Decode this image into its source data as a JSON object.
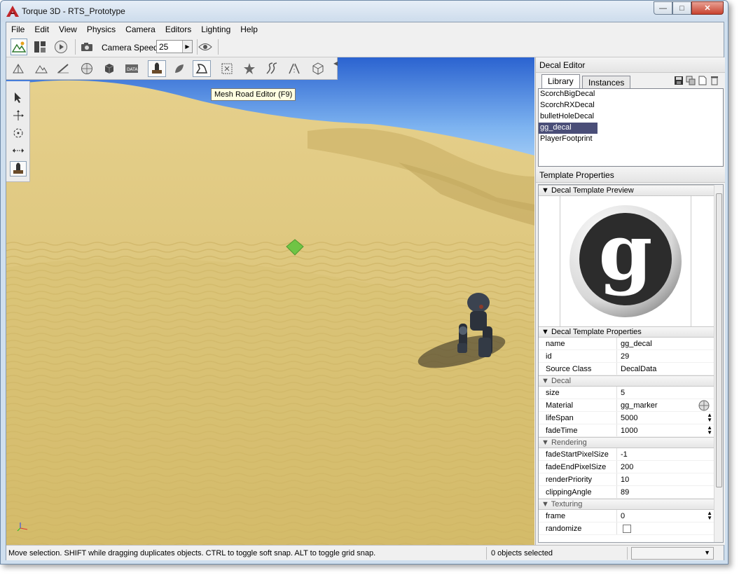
{
  "window": {
    "title": "Torque 3D - RTS_Prototype",
    "minimize": "—",
    "maximize": "□",
    "close": "✕"
  },
  "menu": [
    "File",
    "Edit",
    "View",
    "Physics",
    "Camera",
    "Editors",
    "Lighting",
    "Help"
  ],
  "toolbar": {
    "camera_speed_label": "Camera Speed",
    "camera_speed_value": "25"
  },
  "tooltip": "Mesh Road Editor (F9)",
  "decal_editor": {
    "title": "Decal Editor",
    "tabs": [
      "Library",
      "Instances"
    ],
    "list": [
      "ScorchBigDecal",
      "ScorchRXDecal",
      "bulletHoleDecal",
      "gg_decal",
      "PlayerFootprint"
    ],
    "selected_index": 3
  },
  "template_properties": {
    "title": "Template Properties",
    "preview_section": "Decal Template Preview",
    "props_section": "Decal Template Properties",
    "template_rows": [
      {
        "name": "name",
        "value": "gg_decal"
      },
      {
        "name": "id",
        "value": "29"
      },
      {
        "name": "Source Class",
        "value": "DecalData"
      }
    ],
    "decal_section": "Decal",
    "decal_rows": [
      {
        "name": "size",
        "value": "5"
      },
      {
        "name": "Material",
        "value": "gg_marker"
      },
      {
        "name": "lifeSpan",
        "value": "5000"
      },
      {
        "name": "fadeTime",
        "value": "1000"
      }
    ],
    "rendering_section": "Rendering",
    "rendering_rows": [
      {
        "name": "fadeStartPixelSize",
        "value": "-1"
      },
      {
        "name": "fadeEndPixelSize",
        "value": "200"
      },
      {
        "name": "renderPriority",
        "value": "10"
      },
      {
        "name": "clippingAngle",
        "value": "89"
      }
    ],
    "texturing_section": "Texturing",
    "texturing_rows": [
      {
        "name": "frame",
        "value": "0"
      },
      {
        "name": "randomize",
        "value": ""
      }
    ],
    "preview_glyph": "g"
  },
  "status": {
    "message": "Move selection.  SHIFT while dragging duplicates objects.  CTRL to toggle soft snap.  ALT to toggle grid snap.",
    "selection": "0 objects selected"
  },
  "colors": {
    "selection": "#4a4e78",
    "sand": "#d9c27a",
    "sky": "#4a85e0"
  }
}
